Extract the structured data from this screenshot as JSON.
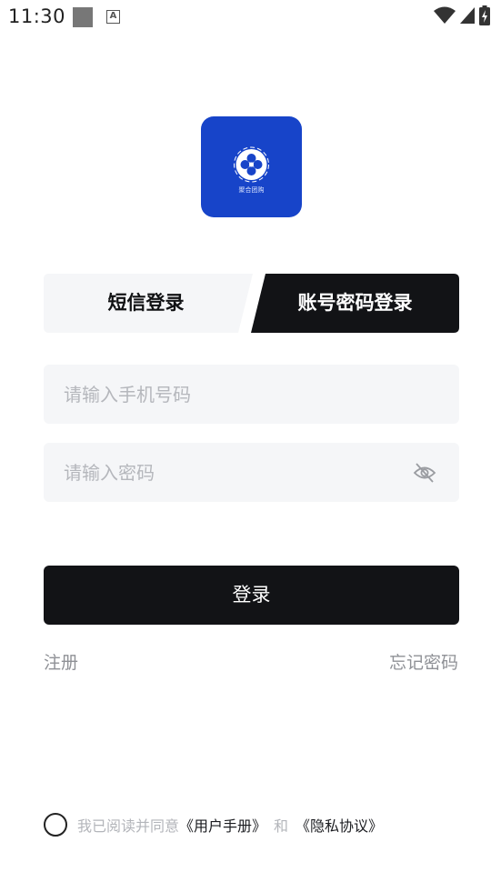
{
  "status_bar": {
    "time": "11:30",
    "notification_icon": "A"
  },
  "logo": {
    "caption": "聚合团购"
  },
  "tabs": [
    {
      "label": "短信登录",
      "active": false
    },
    {
      "label": "账号密码登录",
      "active": true
    }
  ],
  "form": {
    "phone_placeholder": "请输入手机号码",
    "password_placeholder": "请输入密码"
  },
  "login_label": "登录",
  "register_label": "注册",
  "forgot_label": "忘记密码",
  "agreement": {
    "prefix": "我已阅读并同意",
    "user_manual": "《用户手册》",
    "and": "和",
    "privacy": "《隐私协议》"
  },
  "colors": {
    "brand": "#1744c9",
    "dark": "#121316",
    "input_bg": "#f5f6f8"
  }
}
